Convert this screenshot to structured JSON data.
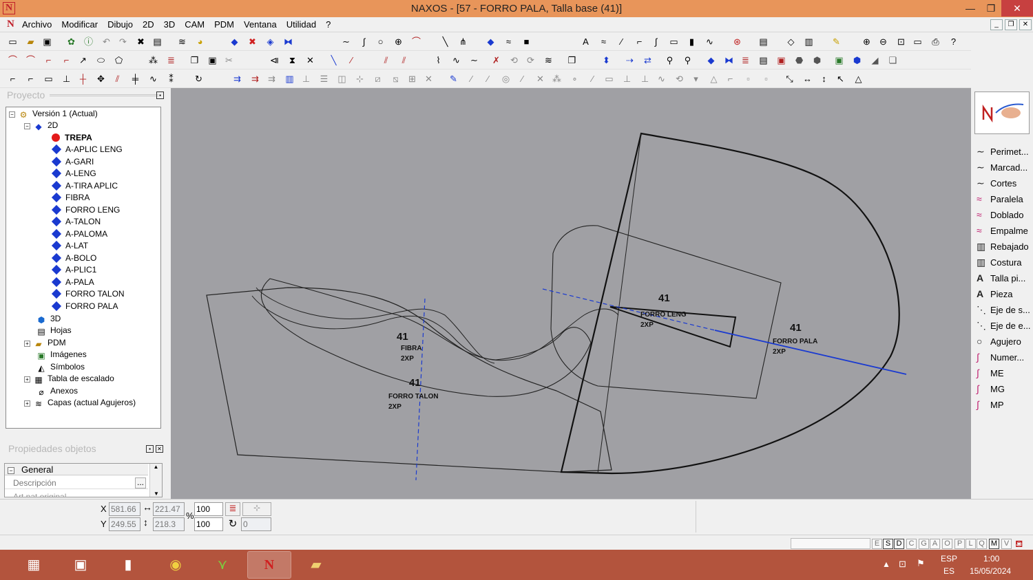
{
  "window": {
    "title": "NAXOS - [57 - FORRO PALA, Talla base (41)]",
    "logo": "N",
    "min": "—",
    "max": "❐",
    "close": "✕"
  },
  "menu": {
    "logo": "N",
    "items": [
      "Archivo",
      "Modificar",
      "Dibujo",
      "2D",
      "3D",
      "CAM",
      "PDM",
      "Ventana",
      "Utilidad",
      "?"
    ]
  },
  "project": {
    "header": "Proyecto",
    "items": [
      {
        "label": "Versión 1 (Actual)"
      },
      {
        "label": "2D"
      },
      {
        "label": "TREPA"
      },
      {
        "label": "A-APLIC LENG"
      },
      {
        "label": "A-GARI"
      },
      {
        "label": "A-LENG"
      },
      {
        "label": "A-TIRA APLIC"
      },
      {
        "label": "FIBRA"
      },
      {
        "label": "FORRO LENG"
      },
      {
        "label": "A-TALON"
      },
      {
        "label": "A-PALOMA"
      },
      {
        "label": "A-LAT"
      },
      {
        "label": "A-BOLO"
      },
      {
        "label": "A-PLIC1"
      },
      {
        "label": "A-PALA"
      },
      {
        "label": "FORRO TALON"
      },
      {
        "label": "FORRO PALA"
      },
      {
        "label": "3D"
      },
      {
        "label": "Hojas"
      },
      {
        "label": "PDM"
      },
      {
        "label": "Imágenes"
      },
      {
        "label": "Símbolos"
      },
      {
        "label": "Tabla de escalado"
      },
      {
        "label": "Anexos"
      },
      {
        "label": "Capas (actual Agujeros)"
      }
    ]
  },
  "props": {
    "header": "Propiedades objetos",
    "group": "General",
    "row1": "Descripción",
    "row1_btn": "...",
    "row2": "Art.nat.original"
  },
  "canvas": {
    "labels": [
      {
        "size": "41",
        "name": "FIBRA",
        "qty": "2XP"
      },
      {
        "size": "41",
        "name": "FORRO TALON",
        "qty": "2XP"
      },
      {
        "size": "41",
        "name": "FORRO LENG",
        "qty": "2XP"
      },
      {
        "size": "41",
        "name": "FORRO PALA",
        "qty": "2XP"
      }
    ]
  },
  "tools": {
    "items": [
      {
        "icon": "∼",
        "label": "Perimet..."
      },
      {
        "icon": "∼",
        "label": "Marcad..."
      },
      {
        "icon": "∼",
        "label": "Cortes"
      },
      {
        "icon": "≈",
        "label": "Paralela"
      },
      {
        "icon": "≈",
        "label": "Doblado"
      },
      {
        "icon": "≈",
        "label": "Empalme"
      },
      {
        "icon": "▥",
        "label": "Rebajado"
      },
      {
        "icon": "▥",
        "label": "Costura"
      },
      {
        "icon": "A",
        "label": "Talla pi..."
      },
      {
        "icon": "A",
        "label": "Pieza"
      },
      {
        "icon": "⋱",
        "label": "Eje de s..."
      },
      {
        "icon": "⋱",
        "label": "Eje de e..."
      },
      {
        "icon": "○",
        "label": "Agujero"
      },
      {
        "icon": "∫",
        "label": "Numer..."
      },
      {
        "icon": "∫",
        "label": "ME"
      },
      {
        "icon": "∫",
        "label": "MG"
      },
      {
        "icon": "∫",
        "label": "MP"
      }
    ]
  },
  "coords": {
    "x_label": "X",
    "y_label": "Y",
    "x": "581.66",
    "y": "249.55",
    "w": "221.47",
    "h": "218.3",
    "pct_label": "%",
    "sx": "100",
    "sy": "100",
    "rot": "0"
  },
  "status": {
    "layers": [
      "E",
      "S",
      "D",
      "C",
      "G",
      "A",
      "O",
      "P",
      "L",
      "Q",
      "M",
      "V"
    ]
  },
  "taskbar": {
    "lang1": "ESP",
    "lang2": "ES",
    "time": "1:00",
    "date": "15/05/2024"
  }
}
